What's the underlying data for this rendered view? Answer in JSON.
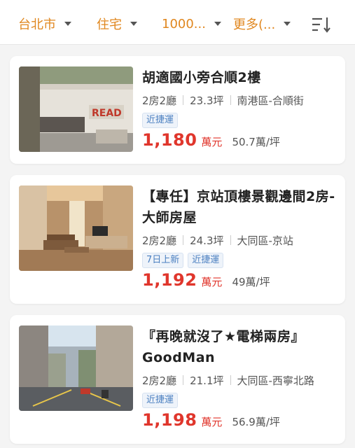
{
  "filters": [
    {
      "label": "台北市"
    },
    {
      "label": "住宅"
    },
    {
      "label": "1000..."
    },
    {
      "label": "更多(..."
    }
  ],
  "sort_icon": "sort-descending-icon",
  "listings": [
    {
      "title": "胡適國小旁合順2樓",
      "layout": "2房2廳",
      "area": "23.3坪",
      "location": "南港區-合順街",
      "tags": [
        "近捷運"
      ],
      "price": "1,180",
      "price_unit": "萬元",
      "unit_price": "50.7萬/坪"
    },
    {
      "title": "【專任】京站頂樓景觀邊間2房-大師房屋",
      "layout": "2房2廳",
      "area": "24.3坪",
      "location": "大同區-京站",
      "tags": [
        "7日上新",
        "近捷運"
      ],
      "price": "1,192",
      "price_unit": "萬元",
      "unit_price": "49萬/坪"
    },
    {
      "title": "『再晚就沒了★電梯兩房』GoodMan",
      "layout": "2房2廳",
      "area": "21.1坪",
      "location": "大同區-西寧北路",
      "tags": [
        "近捷運"
      ],
      "price": "1,198",
      "price_unit": "萬元",
      "unit_price": "56.9萬/坪"
    }
  ],
  "colors": {
    "accent": "#e0871f",
    "price": "#e0362c",
    "tag_text": "#4a7fc0"
  }
}
